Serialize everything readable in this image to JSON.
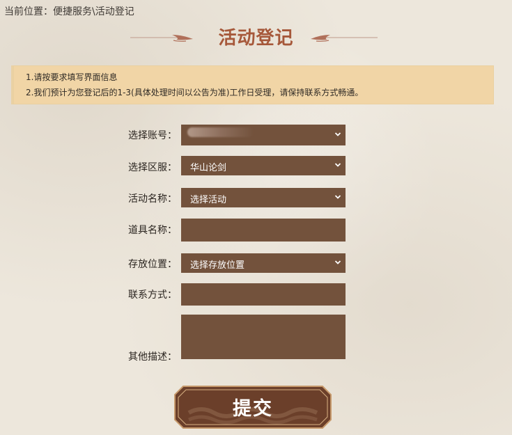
{
  "breadcrumb": {
    "text": "当前位置：便捷服务\\活动登记"
  },
  "page": {
    "title": "活动登记"
  },
  "notice": {
    "line1": "1.请按要求填写界面信息",
    "line2": "2.我们预计为您登记后的1-3(具体处理时间以公告为准)工作日受理，请保持联系方式畅通。"
  },
  "form": {
    "account": {
      "label": "选择账号：",
      "value": ""
    },
    "server": {
      "label": "选择区服：",
      "value": "华山论剑"
    },
    "activity": {
      "label": "活动名称：",
      "value": "选择活动"
    },
    "item": {
      "label": "道具名称：",
      "value": ""
    },
    "storage": {
      "label": "存放位置：",
      "value": "选择存放位置"
    },
    "contact": {
      "label": "联系方式：",
      "value": ""
    },
    "description": {
      "label": "其他描述：",
      "value": ""
    },
    "submit_label": "提交"
  },
  "colors": {
    "field_bg": "#73523c",
    "title": "#a6583a",
    "notice_bg": "#f1d5a6",
    "button_bg": "#6b3f2a"
  },
  "icons": [
    "chevron-down-icon",
    "ornament-left-icon",
    "ornament-right-icon"
  ]
}
